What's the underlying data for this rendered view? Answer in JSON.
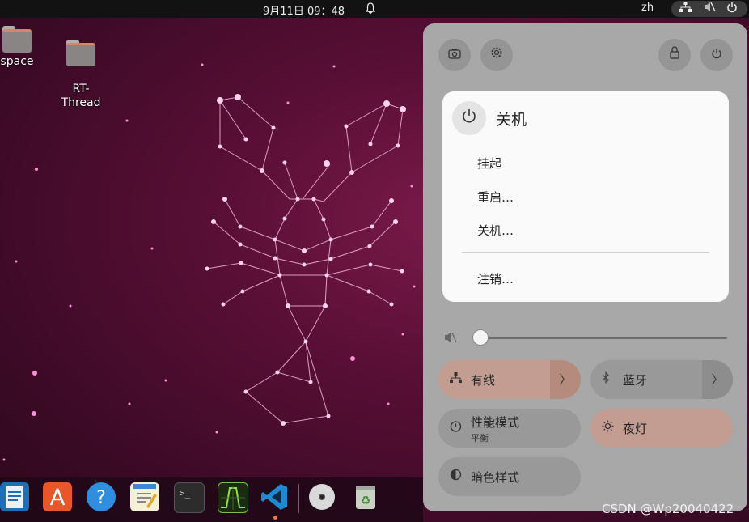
{
  "topbar": {
    "clock": "9月11日  09：48",
    "lang": "zh",
    "bell_icon": "bell-icon",
    "network_icon": "network-icon",
    "volume_icon": "volume-muted-icon",
    "power_icon": "power-icon"
  },
  "desktop": {
    "icons": [
      {
        "label": "space"
      },
      {
        "label": "RT-\nThread"
      }
    ]
  },
  "dock": {
    "items": [
      "libreoffice-writer-icon",
      "app-center-icon",
      "help-icon",
      "text-editor-icon",
      "terminal-icon",
      "system-monitor-icon",
      "vscode-icon",
      "disc-icon",
      "trash-icon"
    ]
  },
  "quick_settings": {
    "top_buttons": [
      "screenshot-icon",
      "settings-icon",
      "lock-icon",
      "power-icon"
    ],
    "power_menu": {
      "title": "关机",
      "items": [
        "挂起",
        "重启…",
        "关机…"
      ],
      "logout": "注销…"
    },
    "tiles": {
      "wired": "有线",
      "bluetooth": "蓝牙",
      "power_mode": "性能模式",
      "power_mode_sub": "平衡",
      "night_light": "夜灯",
      "dark_style": "暗色样式"
    },
    "volume_level": 0
  },
  "watermark": "CSDN @Wp20040422",
  "colors": {
    "accent_tile": "#c39d91",
    "panel_bg": "#a8a8a8",
    "desktop_bg": "#5a0f36"
  }
}
